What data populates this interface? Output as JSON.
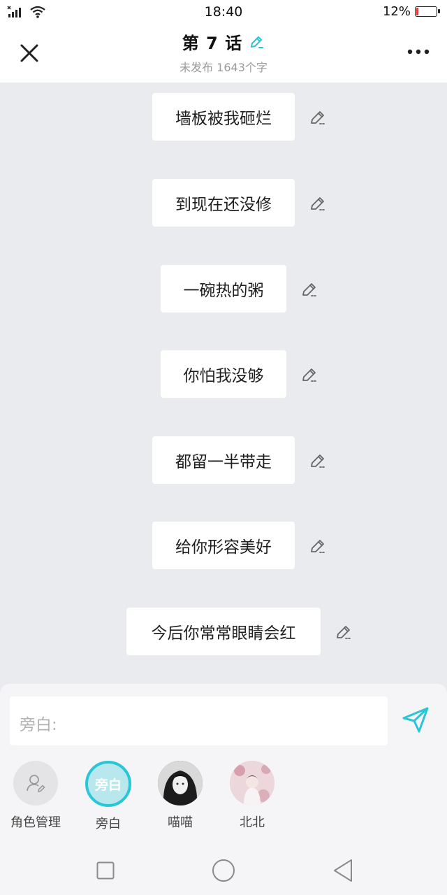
{
  "status": {
    "time": "18:40",
    "battery": "12%",
    "battery_level": 0.12,
    "icons": [
      "signal-icon",
      "wifi-icon",
      "battery-icon"
    ]
  },
  "header": {
    "title": "第 7 话",
    "subtitle": "未发布 1643个字",
    "close_icon": "close-icon",
    "more_icon": "more-icon",
    "title_edit_icon": "edit-icon"
  },
  "lines": [
    {
      "text": "墙板被我砸烂"
    },
    {
      "text": "到现在还没修"
    },
    {
      "text": "一碗热的粥"
    },
    {
      "text": "你怕我没够"
    },
    {
      "text": "都留一半带走"
    },
    {
      "text": "给你形容美好"
    },
    {
      "text": "今后你常常眼睛会红"
    }
  ],
  "composer": {
    "label": "旁白:",
    "send_icon": "send-icon"
  },
  "roles": [
    {
      "label": "角色管理",
      "icon": "role-manage-icon"
    },
    {
      "label": "旁白",
      "avatar_text": "旁白",
      "selected": true
    },
    {
      "label": "喵喵"
    },
    {
      "label": "北北"
    }
  ],
  "colors": {
    "accent": "#29c6d6",
    "background": "#eaebef",
    "battery_low": "#e53935"
  },
  "nav": {
    "icons": [
      "recent-apps-icon",
      "home-icon",
      "back-icon"
    ]
  }
}
